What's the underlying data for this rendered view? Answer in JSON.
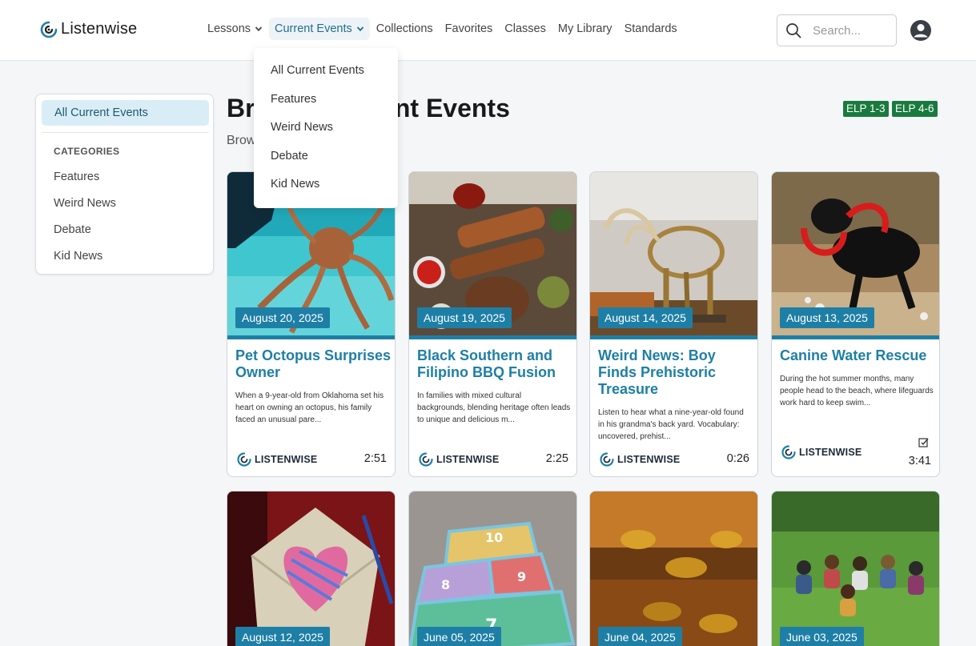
{
  "header": {
    "logo_text": "Listenwise",
    "nav": [
      "Lessons",
      "Current Events",
      "Collections",
      "Favorites",
      "Classes",
      "My Library",
      "Standards"
    ],
    "search_placeholder": "Search..."
  },
  "dropdown": {
    "items": [
      "All Current Events",
      "Features",
      "Weird News",
      "Debate",
      "Kid News"
    ]
  },
  "sidebar": {
    "active": "All Current Events",
    "heading": "CATEGORIES",
    "items": [
      "Features",
      "Weird News",
      "Debate",
      "Kid News"
    ]
  },
  "main": {
    "title": "Browse Current Events",
    "subtitle": "Browse Current Events",
    "elp_badges": [
      "ELP 1-3",
      "ELP 4-6"
    ]
  },
  "brand_label": "LISTENWISE",
  "colors": {
    "accent": "#1e7fa6",
    "elp_green": "#1a7a3e",
    "active_bg": "#d9edf7"
  },
  "cards": [
    {
      "date": "August 20, 2025",
      "title": "Pet Octopus Surprises Owner",
      "description": "When a 9-year-old from Oklahoma set his heart on owning an octopus, his family faced an unusual pare...",
      "duration": "2:51"
    },
    {
      "date": "August 19, 2025",
      "title": "Black Southern and Filipino BBQ Fusion",
      "description": "In families with mixed cultural backgrounds, blending heritage often leads to unique and delicious m...",
      "duration": "2:25"
    },
    {
      "date": "August 14, 2025",
      "title": "Weird News: Boy Finds Prehistoric Treasure",
      "description": "Listen to hear what a nine-year-old found in his grandma's back yard. Vocabulary: uncovered, prehist...",
      "duration": "0:26"
    },
    {
      "date": "August 13, 2025",
      "title": "Canine Water Rescue",
      "description": "During the hot summer months, many people head to the beach, where lifeguards work hard to keep swim...",
      "duration": "3:41"
    },
    {
      "date": "August 12, 2025"
    },
    {
      "date": "June 05, 2025"
    },
    {
      "date": "June 04, 2025"
    },
    {
      "date": "June 03, 2025"
    }
  ]
}
